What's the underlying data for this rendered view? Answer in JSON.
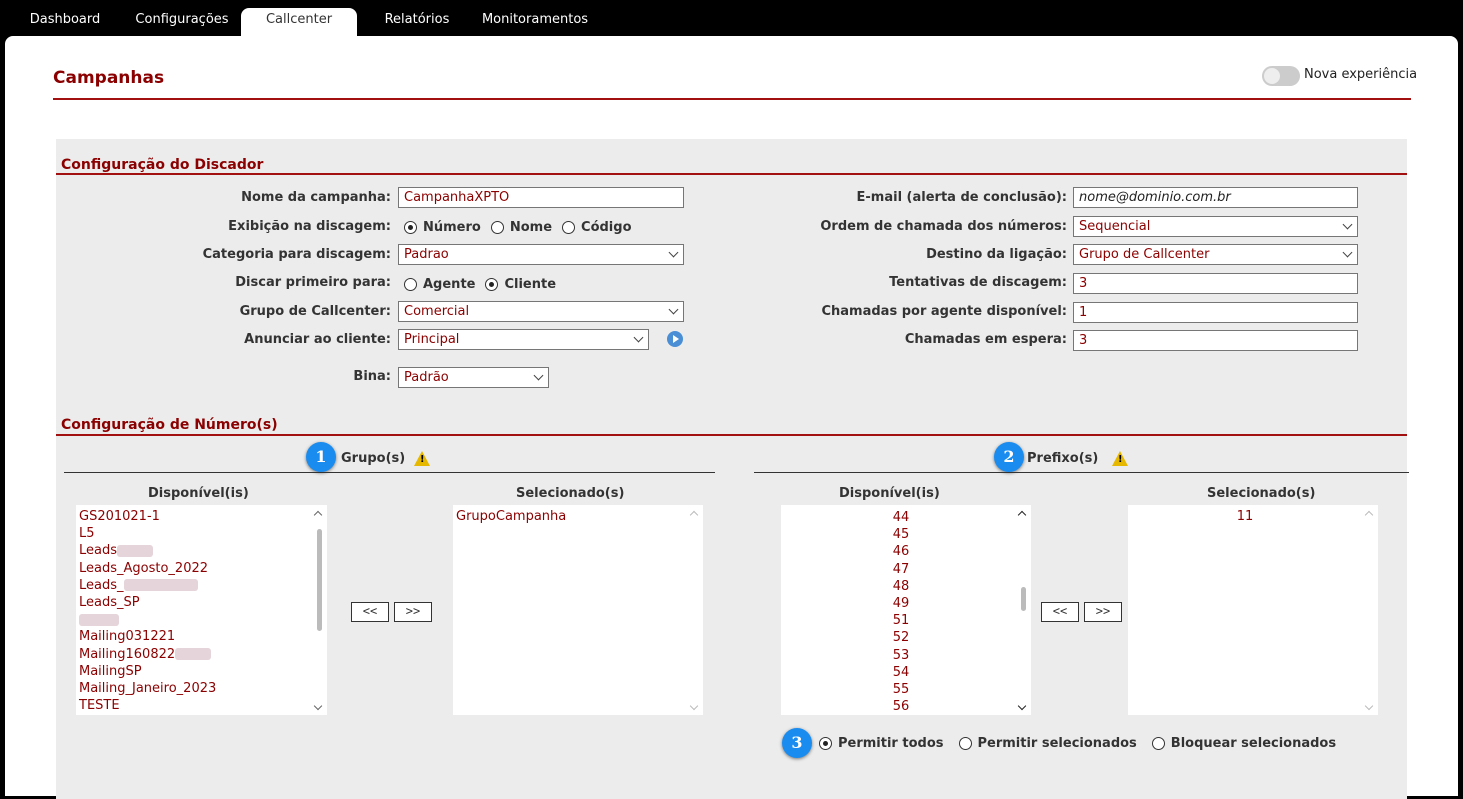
{
  "nav": {
    "tabs": [
      "Dashboard",
      "Configurações",
      "Callcenter",
      "Relatórios",
      "Monitoramentos"
    ],
    "active": "Callcenter"
  },
  "header": {
    "title": "Campanhas",
    "toggle_label": "Nova experiência",
    "toggle_on": false
  },
  "dialer": {
    "section_title": "Configuração do Discador",
    "campaign_name_label": "Nome da campanha:",
    "campaign_name_value": "CampanhaXPTO",
    "display_label": "Exibição na discagem:",
    "display_options": [
      "Número",
      "Nome",
      "Código"
    ],
    "display_selected": "Número",
    "category_label": "Categoria para discagem:",
    "category_value": "Padrao",
    "dial_first_label": "Discar primeiro para:",
    "dial_first_options": [
      "Agente",
      "Cliente"
    ],
    "dial_first_selected": "Cliente",
    "group_label": "Grupo de Callcenter:",
    "group_value": "Comercial",
    "announce_label": "Anunciar ao cliente:",
    "announce_value": "Principal",
    "bina_label": "Bina:",
    "bina_value": "Padrão",
    "email_label": "E-mail (alerta de conclusão):",
    "email_placeholder": "nome@dominio.com.br",
    "order_label": "Ordem de chamada dos números:",
    "order_value": "Sequencial",
    "destination_label": "Destino da ligação:",
    "destination_value": "Grupo de Callcenter",
    "attempts_label": "Tentativas de discagem:",
    "attempts_value": "3",
    "calls_per_agent_label": "Chamadas por agente disponível:",
    "calls_per_agent_value": "1",
    "calls_waiting_label": "Chamadas em espera:",
    "calls_waiting_value": "3"
  },
  "numbers": {
    "section_title": "Configuração de Número(s)",
    "groups": {
      "badge": "1",
      "title": "Grupo(s)",
      "available_label": "Disponível(is)",
      "selected_label": "Selecionado(s)",
      "available_items": [
        "GS201021-1",
        "L5",
        "Leads",
        "Leads_Agosto_2022",
        "Leads_",
        "Leads_SP",
        "",
        "Mailing031221",
        "Mailing160822",
        "MailingSP",
        "Mailing_Janeiro_2023",
        "TESTE"
      ],
      "selected_items": [
        "GrupoCampanha"
      ],
      "btn_remove": "<<",
      "btn_add": ">>"
    },
    "prefixes": {
      "badge": "2",
      "title": "Prefixo(s)",
      "available_label": "Disponível(is)",
      "selected_label": "Selecionado(s)",
      "available_items": [
        "44",
        "45",
        "46",
        "47",
        "48",
        "49",
        "51",
        "52",
        "53",
        "54",
        "55",
        "56"
      ],
      "selected_items": [
        "11"
      ],
      "btn_remove": "<<",
      "btn_add": ">>"
    },
    "filter": {
      "badge": "3",
      "options": [
        "Permitir todos",
        "Permitir selecionados",
        "Bloquear selecionados"
      ],
      "selected": "Permitir todos"
    }
  }
}
